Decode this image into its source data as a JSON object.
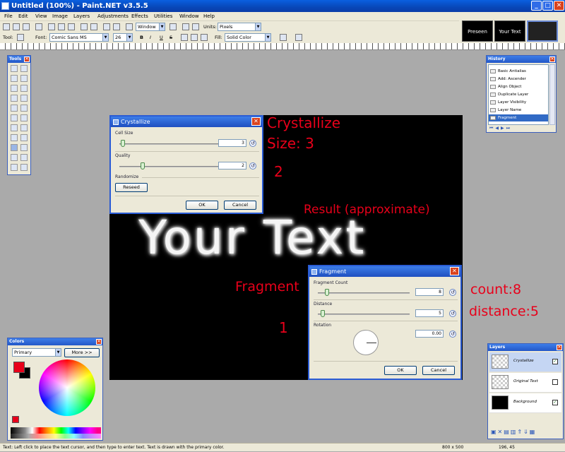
{
  "window": {
    "title": "Untitled (100%) - Paint.NET v3.5.5"
  },
  "menu": [
    "File",
    "Edit",
    "View",
    "Image",
    "Layers",
    "Adjustments",
    "Effects",
    "Utilities",
    "Window",
    "Help"
  ],
  "thumbnails": [
    "Preseen",
    "Your Text"
  ],
  "toolbar1": {
    "window_select": "Window",
    "units_label": "Units:",
    "units_value": "Pixels"
  },
  "toolbar2": {
    "tool_label": "Tool:",
    "font_label": "Font:",
    "font_value": "Comic Sans MS",
    "size_value": "26",
    "bold": "B",
    "italic": "I",
    "underline": "U",
    "strike": "S",
    "fill_label": "Fill:",
    "fill_value": "Solid Color"
  },
  "tools_panel": {
    "title": "Tools"
  },
  "history_panel": {
    "title": "History",
    "items": [
      {
        "label": "Basic Antialias",
        "selected": false
      },
      {
        "label": "Add: Ascender",
        "selected": false
      },
      {
        "label": "Align Object",
        "selected": false
      },
      {
        "label": "Duplicate Layer",
        "selected": false
      },
      {
        "label": "Layer Visibility",
        "selected": false
      },
      {
        "label": "Layer Name",
        "selected": false
      },
      {
        "label": "Fragment",
        "selected": true
      }
    ]
  },
  "colors_panel": {
    "title": "Colors",
    "mode": "Primary",
    "more_button": "More >>",
    "primary_color": "#e8001a",
    "secondary_color": "#000000"
  },
  "layers_panel": {
    "title": "Layers",
    "layers": [
      {
        "name": "Crystallize",
        "checked": true,
        "thumb": "#ffffff",
        "selected": true
      },
      {
        "name": "Original Text",
        "checked": false,
        "thumb": "#ffffff",
        "selected": false
      },
      {
        "name": "Background",
        "checked": true,
        "thumb": "#000000",
        "selected": false
      }
    ]
  },
  "canvas": {
    "text": "Your Text"
  },
  "crystallize_dialog": {
    "title": "Crystallize",
    "cell_size_label": "Cell Size",
    "cell_size_value": "3",
    "quality_label": "Quality",
    "quality_value": "2",
    "randomize_label": "Randomize",
    "reseed_button": "Reseed",
    "ok_button": "OK",
    "cancel_button": "Cancel"
  },
  "fragment_dialog": {
    "title": "Fragment",
    "count_label": "Fragment Count",
    "count_value": "8",
    "distance_label": "Distance",
    "distance_value": "5",
    "rotation_label": "Rotation",
    "rotation_value": "0.00",
    "ok_button": "OK",
    "cancel_button": "Cancel"
  },
  "annotations": {
    "crystallize": "Crystallize",
    "size": "Size: 3",
    "two": "2",
    "result": "Result (approximate)",
    "fragment": "Fragment",
    "one": "1",
    "count": "count:8",
    "distance": "distance:5"
  },
  "status": {
    "hint": "Text: Left click to place the text cursor, and then type to enter text. Text is drawn with the primary color.",
    "size": "800 x 500",
    "coords": "196, 45"
  },
  "colors": {
    "accent": "#e8001a",
    "titlebar": "#0a5fe0"
  }
}
